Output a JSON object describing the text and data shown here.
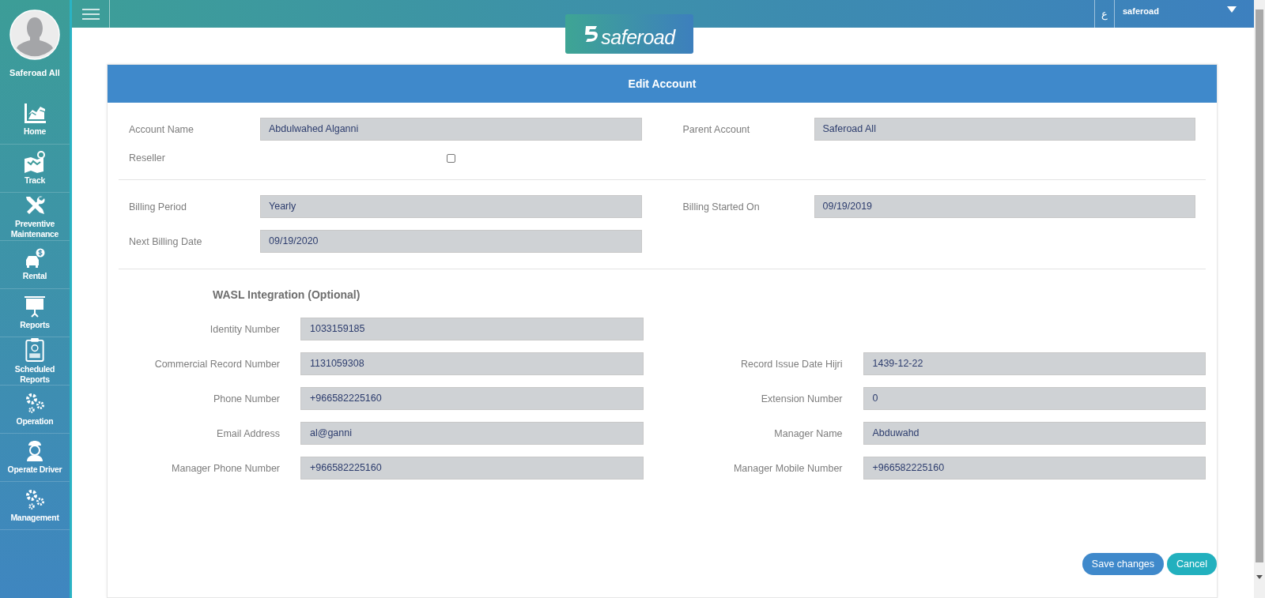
{
  "sidebar": {
    "user_name": "Saferoad All",
    "items": [
      {
        "label": "Home"
      },
      {
        "label": "Track"
      },
      {
        "label": "Preventive Maintenance"
      },
      {
        "label": "Rental"
      },
      {
        "label": "Reports"
      },
      {
        "label": "Scheduled Reports"
      },
      {
        "label": "Operation"
      },
      {
        "label": "Operate Driver"
      },
      {
        "label": "Management"
      }
    ]
  },
  "topbar": {
    "logo": "saferoad",
    "language": "ع",
    "user": "saferoad"
  },
  "form": {
    "title": "Edit Account",
    "sections": [
      {
        "rows": [
          [
            {
              "kind": "text",
              "label": "Account Name",
              "value": "Abdulwahed Alganni"
            },
            {
              "kind": "text",
              "label": "Parent Account",
              "value": "Saferoad All"
            }
          ],
          [
            {
              "kind": "checkbox",
              "label": "Reseller",
              "checked": false
            }
          ]
        ]
      },
      {
        "rows": [
          [
            {
              "kind": "text",
              "label": "Billing Period",
              "value": "Yearly"
            },
            {
              "kind": "text",
              "label": "Billing Started On",
              "value": "09/19/2019"
            }
          ],
          [
            {
              "kind": "text",
              "label": "Next Billing Date",
              "value": "09/19/2020"
            }
          ]
        ]
      }
    ],
    "wasl": {
      "heading": "WASL Integration (Optional)",
      "rows": [
        [
          {
            "label": "Identity Number",
            "value": "1033159185"
          }
        ],
        [
          {
            "label": "Commercial Record Number",
            "value": "1131059308"
          },
          {
            "label": "Record Issue Date Hijri",
            "value": "1439-12-22"
          }
        ],
        [
          {
            "label": "Phone Number",
            "value": "+966582225160"
          },
          {
            "label": "Extension Number",
            "value": "0"
          }
        ],
        [
          {
            "label": "Email Address",
            "value": "al@ganni"
          },
          {
            "label": "Manager Name",
            "value": "Abduwahd"
          }
        ],
        [
          {
            "label": "Manager Phone Number",
            "value": "+966582225160"
          },
          {
            "label": "Manager Mobile Number",
            "value": "+966582225160"
          }
        ]
      ]
    },
    "buttons": [
      {
        "kind": "primary",
        "label": "Save changes"
      },
      {
        "kind": "secondary",
        "label": "Cancel"
      }
    ]
  }
}
